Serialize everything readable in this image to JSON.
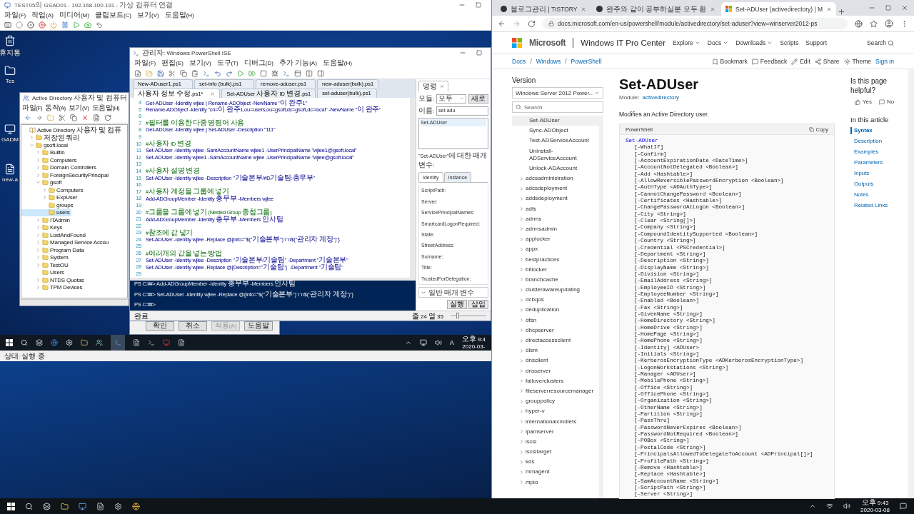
{
  "vm": {
    "title": "TEST05의 GSAD01 - 192.168.100.191 - 가상 컴퓨터 연결",
    "menu": [
      "파일(F)",
      "작업(A)",
      "미디어(M)",
      "클립보드(C)",
      "보기(V)",
      "도움말(H)"
    ],
    "desktop_icons": [
      {
        "label": "휴지통"
      },
      {
        "label": "Tes"
      },
      {
        "label": "GADM"
      },
      {
        "label": "new-a"
      }
    ],
    "ad_window": {
      "title": "Active Directory 사용자 및 컴퓨터",
      "menu": [
        "파일(F)",
        "동작(A)",
        "보기(V)",
        "도움말(H)"
      ],
      "tree": [
        {
          "label": "Active Directory 사용자 및 컴퓨",
          "selected": false,
          "children": [
            {
              "label": "저장된 쿼리",
              "selected": false,
              "expanded": false
            },
            {
              "label": "gsoft.local",
              "selected": false,
              "expanded": true,
              "children": [
                {
                  "label": "Builtin",
                  "selected": false,
                  "expanded": false
                },
                {
                  "label": "Computers",
                  "selected": false,
                  "expanded": false
                },
                {
                  "label": "Domain Controllers",
                  "selected": false,
                  "expanded": false
                },
                {
                  "label": "ForeignSecurityPrincipal",
                  "selected": false,
                  "expanded": false
                },
                {
                  "label": "gsoft",
                  "selected": false,
                  "expanded": true,
                  "children": [
                    {
                      "label": "Computers",
                      "selected": false,
                      "expanded": false
                    },
                    {
                      "label": "ExpUser",
                      "selected": false,
                      "expanded": false
                    },
                    {
                      "label": "groups",
                      "selected": false
                    },
                    {
                      "label": "users",
                      "selected": true
                    }
                  ]
                },
                {
                  "label": "ITAdmin",
                  "selected": false,
                  "expanded": false
                },
                {
                  "label": "Keys",
                  "selected": false,
                  "expanded": false
                },
                {
                  "label": "LostAndFound",
                  "selected": false,
                  "expanded": false
                },
                {
                  "label": "Managed Service Accou",
                  "selected": false,
                  "expanded": false
                },
                {
                  "label": "Program Data",
                  "selected": false,
                  "expanded": false
                },
                {
                  "label": "System",
                  "selected": false,
                  "expanded": false
                },
                {
                  "label": "TestOU",
                  "selected": false,
                  "expanded": false
                },
                {
                  "label": "Users",
                  "selected": false
                },
                {
                  "label": "NTDS Quotas",
                  "selected": false,
                  "expanded": false
                },
                {
                  "label": "TPM Devices",
                  "selected": false,
                  "expanded": false
                }
              ]
            }
          ]
        }
      ]
    },
    "properties_dialog": {
      "buttons": [
        {
          "label": "확인",
          "disabled": false
        },
        {
          "label": "취소",
          "disabled": false
        },
        {
          "label": "적용(A)",
          "disabled": true
        },
        {
          "label": "도움말",
          "disabled": false
        }
      ]
    },
    "ise": {
      "title": "관리자: Windows PowerShell ISE",
      "menu": [
        "파일(F)",
        "편집(E)",
        "보기(V)",
        "도구(T)",
        "디버그(D)",
        "추가 기능(A)",
        "도움말(H)"
      ],
      "tabs_row1": [
        {
          "label": "New-ADuser1.ps1",
          "selected": false
        },
        {
          "label": "set-info (bulk).ps1",
          "selected": false
        },
        {
          "label": "remove-aduser.ps1",
          "selected": false
        },
        {
          "label": "new-aduser(bulk).ps1",
          "selected": false
        }
      ],
      "tabs_row2": [
        {
          "label": "사용자 정보 수정.ps1*",
          "selected": true
        },
        {
          "label": "Set-ADUser 사용자 ID 변경.ps1",
          "selected": false
        },
        {
          "label": "set-aduser(bulk).ps1",
          "selected": false
        }
      ],
      "script": [
        {
          "number": "4",
          "kind": "code",
          "text": "Get-ADUser -Identity wjlee | Rename-ADObject -NewName \"이 완주1\""
        },
        {
          "number": "5",
          "kind": "code",
          "text": "Rename-ADObject -Identity \"cn=이 완주1,ou=users,ou=gsoft,dc=gsoft,dc=local\" -NewName \"이 완주\""
        },
        {
          "number": "6",
          "kind": "blank"
        },
        {
          "number": "7",
          "kind": "comment",
          "text": "#필터를 이용한 다중 명령어 사용"
        },
        {
          "number": "8",
          "kind": "code",
          "text": "Get-ADUser -Identity wjlee | Set-ADUser -Description \"111\""
        },
        {
          "number": "9",
          "kind": "blank"
        },
        {
          "number": "10",
          "kind": "comment",
          "text": "#사용자 ID 변경"
        },
        {
          "number": "11",
          "kind": "code",
          "text": "Set-ADUser -Identity wjlee -SamAccountName wjlee1 -UserPrincipalName \"wjlee1@gsoft.local\""
        },
        {
          "number": "12",
          "kind": "code",
          "text": "Set-ADUser -Identity wjlee1 -SamAccountName wjlee -UserPrincipalName \"wjlee@gsoft.local\""
        },
        {
          "number": "13",
          "kind": "blank"
        },
        {
          "number": "14",
          "kind": "comment",
          "text": "#사용자 설명 변경"
        },
        {
          "number": "15",
          "kind": "code",
          "text": "Set-ADUser -Identity wjlee -Description \"기술본부/#D기술팀:총무부\""
        },
        {
          "number": "16",
          "kind": "blank"
        },
        {
          "number": "17",
          "kind": "comment",
          "text": "#사용자 계정을 그룹에 넣기"
        },
        {
          "number": "18",
          "kind": "code",
          "text": "Add-ADGroupMember -Identity 총무부 -Members wjlee"
        },
        {
          "number": "19",
          "kind": "blank"
        },
        {
          "number": "20",
          "kind": "comment",
          "text": "#그룹을 그룹에 넣기 (Nested Group 중첩그룹)"
        },
        {
          "number": "21",
          "kind": "code",
          "text": "Add-ADGroupMember -Identity 총무부 -Members 인사팀"
        },
        {
          "number": "22",
          "kind": "blank"
        },
        {
          "number": "23",
          "kind": "comment",
          "text": "#참조에 값 넣기"
        },
        {
          "number": "24",
          "kind": "code",
          "text": "Set-ADUser -Identity wjlee -Replace @{info=\"$(\"기술본부\")`r`n$(\"관리자 계정\")\"}"
        },
        {
          "number": "25",
          "kind": "blank"
        },
        {
          "number": "26",
          "kind": "comment",
          "text": "#여러개의 값을 넣는 방법"
        },
        {
          "number": "27",
          "kind": "code",
          "text": "Set-ADUser -Identity wjlee -Description \"기술본부/기술팀\" -Department \"기술본부\""
        },
        {
          "number": "28",
          "kind": "code",
          "text": "Set-ADUser -Identity wjlee -Replace @{Description=\"기술팀\"}  -Department \"기술팀\""
        },
        {
          "number": "29",
          "kind": "blank"
        }
      ],
      "console": [
        {
          "prompt": "PS C:₩>",
          "command": "Add-ADGroupMember -Identity 총무부 -Members 인사팀"
        },
        {
          "prompt": "PS C:₩>",
          "command": "Set-ADUser -Identity wjlee -Replace @{info=\"$(\"기술본부\")`r`n$(\"관리자 계정\")\"}"
        },
        {
          "prompt": "PS C:₩>"
        }
      ],
      "commands": {
        "tab": "명령",
        "module_label": "모듈:",
        "module_value": "모두",
        "refresh": "새로",
        "name_label": "이름:",
        "name_value": "set-adu",
        "results": [
          "Set-ADUser"
        ],
        "params_title": "\"Set-ADUser\"에 대한 매개 변수:",
        "param_tabs": [
          {
            "label": "Identity",
            "selected": true
          },
          {
            "label": "Instance",
            "selected": false
          }
        ],
        "fields": [
          "ScriptPath:",
          "Server:",
          "ServicePrincipalNames:",
          "SmartcardLogonRequired:",
          "State:",
          "StreetAddress:",
          "Surname:",
          "Title:",
          "TrustedForDelegation:"
        ],
        "common": "일반 매개 변수",
        "buttons": [
          "실행",
          "삽입"
        ]
      },
      "status": "완료",
      "position": "줄 24 열 35",
      "zoom": {
        "level": 0.2
      }
    },
    "taskbar": {
      "ime": "A",
      "time": "오후 9:4",
      "date": "2020-03-"
    },
    "status": "상태: 실행 중"
  },
  "browser": {
    "tabs": [
      {
        "label": "블로그관리 | TISTORY",
        "selected": false,
        "kind": "tistory"
      },
      {
        "label": "완주와 같이 공부하실분 모두 환",
        "selected": false,
        "kind": "tistory"
      },
      {
        "label": "Set-ADUser (activedirectory) | M",
        "selected": true,
        "kind": "microsoft"
      }
    ],
    "url": "docs.microsoft.com/en-us/powershell/module/activedirectory/set-aduser?view=winserver2012-ps",
    "brand": "Microsoft",
    "site": "Windows IT Pro Center",
    "nav": [
      {
        "label": "Explore",
        "dropdown": true
      },
      {
        "label": "Docs",
        "dropdown": true
      },
      {
        "label": "Downloads",
        "dropdown": true
      },
      {
        "label": "Scripts",
        "dropdown": false
      },
      {
        "label": "Support",
        "dropdown": false
      }
    ],
    "search": "Search",
    "breadcrumb": [
      {
        "label": "Docs"
      },
      {
        "separator": "/",
        "label": "Windows"
      },
      {
        "separator": "/",
        "label": "PowerShell"
      }
    ],
    "actions": [
      {
        "label": "Bookmark",
        "kind": "bookmark"
      },
      {
        "label": "Feedback",
        "kind": "feedback"
      },
      {
        "label": "Edit",
        "kind": "edit"
      },
      {
        "label": "Share",
        "kind": "share"
      },
      {
        "label": "Theme",
        "kind": "theme"
      }
    ],
    "sign_in": "Sign in",
    "sidebar": {
      "version_label": "Version",
      "version_value": "Windows Server 2012 Power...",
      "search_placeholder": "Search",
      "items": [
        {
          "label": "Set-ADUser",
          "selected": true
        },
        {
          "label": "Sync-ADObject",
          "selected": false
        },
        {
          "label": "Test-ADServiceAccount",
          "selected": false
        },
        {
          "label": "Uninstall-ADServiceAccount",
          "selected": false
        },
        {
          "label": "Unlock-ADAccount",
          "selected": false
        }
      ],
      "groups": [
        {
          "label": "adcsadministration",
          "expanded": false
        },
        {
          "label": "adcsdeployment",
          "expanded": false
        },
        {
          "label": "addsdeployment",
          "expanded": false
        },
        {
          "label": "adfs",
          "expanded": false
        },
        {
          "label": "adrms",
          "expanded": false
        },
        {
          "label": "adrmsadmin",
          "expanded": false
        },
        {
          "label": "applocker",
          "expanded": false
        },
        {
          "label": "appx",
          "expanded": false
        },
        {
          "label": "bestpractices",
          "expanded": false
        },
        {
          "label": "bitlocker",
          "expanded": false
        },
        {
          "label": "branchcache",
          "expanded": false
        },
        {
          "label": "clusterawareupdating",
          "expanded": false
        },
        {
          "label": "dcbqos",
          "expanded": false
        },
        {
          "label": "deduplication",
          "expanded": false
        },
        {
          "label": "dfsn",
          "expanded": false
        },
        {
          "label": "dhcpserver",
          "expanded": false
        },
        {
          "label": "directaccessclient",
          "expanded": false
        },
        {
          "label": "dism",
          "expanded": false
        },
        {
          "label": "dnsclient",
          "expanded": false
        },
        {
          "label": "dnsserver",
          "expanded": false
        },
        {
          "label": "failoverclusters",
          "expanded": false
        },
        {
          "label": "fileserverresourcemanager",
          "expanded": false
        },
        {
          "label": "grouppolicy",
          "expanded": false
        },
        {
          "label": "hyper-v",
          "expanded": false
        },
        {
          "label": "internationalcmdlets",
          "expanded": false
        },
        {
          "label": "ipamserver",
          "expanded": false
        },
        {
          "label": "iscsi",
          "expanded": false
        },
        {
          "label": "iscsitarget",
          "expanded": false
        },
        {
          "label": "kds",
          "expanded": false
        },
        {
          "label": "mmagent",
          "expanded": false
        },
        {
          "label": "mpio",
          "expanded": false
        }
      ]
    },
    "article": {
      "title": "Set-ADUser",
      "module_label": "Module:",
      "module": "activedirectory",
      "summary": "Modifies an Active Directory user.",
      "code_lang": "PowerShell",
      "copy": "Copy",
      "code": [
        {
          "kind": "command",
          "text": "Set-ADUser"
        },
        {
          "kind": "param",
          "text": "[-WhatIf]"
        },
        {
          "kind": "param",
          "text": "[-Confirm]"
        },
        {
          "kind": "param",
          "text": "[-AccountExpirationDate <DateTime>]"
        },
        {
          "kind": "param",
          "text": "[-AccountNotDelegated <Boolean>]"
        },
        {
          "kind": "param",
          "text": "[-Add <Hashtable>]"
        },
        {
          "kind": "param",
          "text": "[-AllowReversiblePasswordEncryption <Boolean>]"
        },
        {
          "kind": "param",
          "text": "[-AuthType <ADAuthType>]"
        },
        {
          "kind": "param",
          "text": "[-CannotChangePassword <Boolean>]"
        },
        {
          "kind": "param",
          "text": "[-Certificates <Hashtable>]"
        },
        {
          "kind": "param",
          "text": "[-ChangePasswordAtLogon <Boolean>]"
        },
        {
          "kind": "param",
          "text": "[-City <String>]"
        },
        {
          "kind": "param",
          "text": "[-Clear <String[]>]"
        },
        {
          "kind": "param",
          "text": "[-Company <String>]"
        },
        {
          "kind": "param",
          "text": "[-CompoundIdentitySupported <Boolean>]"
        },
        {
          "kind": "param",
          "text": "[-Country <String>]"
        },
        {
          "kind": "param",
          "text": "[-Credential <PSCredential>]"
        },
        {
          "kind": "param",
          "text": "[-Department <String>]"
        },
        {
          "kind": "param",
          "text": "[-Description <String>]"
        },
        {
          "kind": "param",
          "text": "[-DisplayName <String>]"
        },
        {
          "kind": "param",
          "text": "[-Division <String>]"
        },
        {
          "kind": "param",
          "text": "[-EmailAddress <String>]"
        },
        {
          "kind": "param",
          "text": "[-EmployeeID <String>]"
        },
        {
          "kind": "param",
          "text": "[-EmployeeNumber <String>]"
        },
        {
          "kind": "param",
          "text": "[-Enabled <Boolean>]"
        },
        {
          "kind": "param",
          "text": "[-Fax <String>]"
        },
        {
          "kind": "param",
          "text": "[-GivenName <String>]"
        },
        {
          "kind": "param",
          "text": "[-HomeDirectory <String>]"
        },
        {
          "kind": "param",
          "text": "[-HomeDrive <String>]"
        },
        {
          "kind": "param",
          "text": "[-HomePage <String>]"
        },
        {
          "kind": "param",
          "text": "[-HomePhone <String>]"
        },
        {
          "kind": "param",
          "text": "[-Identity] <ADUser>"
        },
        {
          "kind": "param",
          "text": "[-Initials <String>]"
        },
        {
          "kind": "param",
          "text": "[-KerberosEncryptionType <ADKerberosEncryptionType>]"
        },
        {
          "kind": "param",
          "text": "[-LogonWorkstations <String>]"
        },
        {
          "kind": "param",
          "text": "[-Manager <ADUser>]"
        },
        {
          "kind": "param",
          "text": "[-MobilePhone <String>]"
        },
        {
          "kind": "param",
          "text": "[-Office <String>]"
        },
        {
          "kind": "param",
          "text": "[-OfficePhone <String>]"
        },
        {
          "kind": "param",
          "text": "[-Organization <String>]"
        },
        {
          "kind": "param",
          "text": "[-OtherName <String>]"
        },
        {
          "kind": "param",
          "text": "[-Partition <String>]"
        },
        {
          "kind": "param",
          "text": "[-PassThru]"
        },
        {
          "kind": "param",
          "text": "[-PasswordNeverExpires <Boolean>]"
        },
        {
          "kind": "param",
          "text": "[-PasswordNotRequired <Boolean>]"
        },
        {
          "kind": "param",
          "text": "[-POBox <String>]"
        },
        {
          "kind": "param",
          "text": "[-PostalCode <String>]"
        },
        {
          "kind": "param",
          "text": "[-PrincipalsAllowedToDelegateToAccount <ADPrincipal[]>]"
        },
        {
          "kind": "param",
          "text": "[-ProfilePath <String>]"
        },
        {
          "kind": "param",
          "text": "[-Remove <Hashtable>]"
        },
        {
          "kind": "param",
          "text": "[-Replace <Hashtable>]"
        },
        {
          "kind": "param",
          "text": "[-SamAccountName <String>]"
        },
        {
          "kind": "param",
          "text": "[-ScriptPath <String>]"
        },
        {
          "kind": "param",
          "text": "[-Server <String>]"
        }
      ]
    },
    "aside": {
      "helpful": "Is this page helpful?",
      "yes": "Yes",
      "no": "No",
      "toc_title": "In this article",
      "toc": [
        {
          "label": "Syntax",
          "selected": true
        },
        {
          "label": "Description",
          "selected": false
        },
        {
          "label": "Examples",
          "selected": false
        },
        {
          "label": "Parameters",
          "selected": false
        },
        {
          "label": "Inputs",
          "selected": false
        },
        {
          "label": "Outputs",
          "selected": false
        },
        {
          "label": "Notes",
          "selected": false
        },
        {
          "label": "Related Links",
          "selected": false
        }
      ]
    }
  },
  "taskbar": {
    "time": "오후 9:43",
    "date": "2020-03-08"
  }
}
